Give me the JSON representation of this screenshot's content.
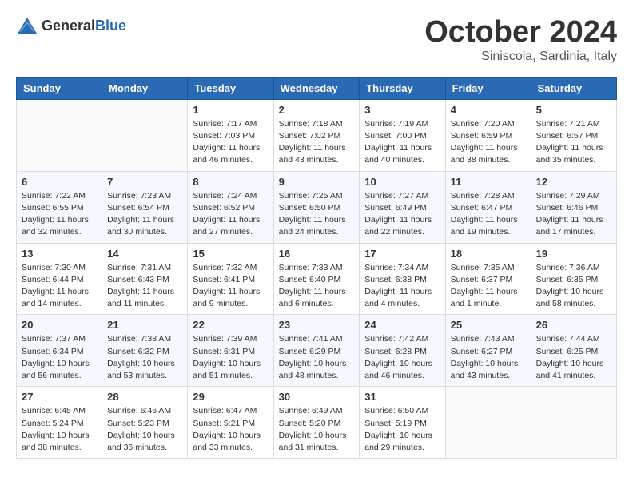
{
  "header": {
    "logo_general": "General",
    "logo_blue": "Blue",
    "month_title": "October 2024",
    "location": "Siniscola, Sardinia, Italy"
  },
  "days_of_week": [
    "Sunday",
    "Monday",
    "Tuesday",
    "Wednesday",
    "Thursday",
    "Friday",
    "Saturday"
  ],
  "weeks": [
    [
      {
        "day": "",
        "info": ""
      },
      {
        "day": "",
        "info": ""
      },
      {
        "day": "1",
        "info": "Sunrise: 7:17 AM\nSunset: 7:03 PM\nDaylight: 11 hours and 46 minutes."
      },
      {
        "day": "2",
        "info": "Sunrise: 7:18 AM\nSunset: 7:02 PM\nDaylight: 11 hours and 43 minutes."
      },
      {
        "day": "3",
        "info": "Sunrise: 7:19 AM\nSunset: 7:00 PM\nDaylight: 11 hours and 40 minutes."
      },
      {
        "day": "4",
        "info": "Sunrise: 7:20 AM\nSunset: 6:59 PM\nDaylight: 11 hours and 38 minutes."
      },
      {
        "day": "5",
        "info": "Sunrise: 7:21 AM\nSunset: 6:57 PM\nDaylight: 11 hours and 35 minutes."
      }
    ],
    [
      {
        "day": "6",
        "info": "Sunrise: 7:22 AM\nSunset: 6:55 PM\nDaylight: 11 hours and 32 minutes."
      },
      {
        "day": "7",
        "info": "Sunrise: 7:23 AM\nSunset: 6:54 PM\nDaylight: 11 hours and 30 minutes."
      },
      {
        "day": "8",
        "info": "Sunrise: 7:24 AM\nSunset: 6:52 PM\nDaylight: 11 hours and 27 minutes."
      },
      {
        "day": "9",
        "info": "Sunrise: 7:25 AM\nSunset: 6:50 PM\nDaylight: 11 hours and 24 minutes."
      },
      {
        "day": "10",
        "info": "Sunrise: 7:27 AM\nSunset: 6:49 PM\nDaylight: 11 hours and 22 minutes."
      },
      {
        "day": "11",
        "info": "Sunrise: 7:28 AM\nSunset: 6:47 PM\nDaylight: 11 hours and 19 minutes."
      },
      {
        "day": "12",
        "info": "Sunrise: 7:29 AM\nSunset: 6:46 PM\nDaylight: 11 hours and 17 minutes."
      }
    ],
    [
      {
        "day": "13",
        "info": "Sunrise: 7:30 AM\nSunset: 6:44 PM\nDaylight: 11 hours and 14 minutes."
      },
      {
        "day": "14",
        "info": "Sunrise: 7:31 AM\nSunset: 6:43 PM\nDaylight: 11 hours and 11 minutes."
      },
      {
        "day": "15",
        "info": "Sunrise: 7:32 AM\nSunset: 6:41 PM\nDaylight: 11 hours and 9 minutes."
      },
      {
        "day": "16",
        "info": "Sunrise: 7:33 AM\nSunset: 6:40 PM\nDaylight: 11 hours and 6 minutes."
      },
      {
        "day": "17",
        "info": "Sunrise: 7:34 AM\nSunset: 6:38 PM\nDaylight: 11 hours and 4 minutes."
      },
      {
        "day": "18",
        "info": "Sunrise: 7:35 AM\nSunset: 6:37 PM\nDaylight: 11 hours and 1 minute."
      },
      {
        "day": "19",
        "info": "Sunrise: 7:36 AM\nSunset: 6:35 PM\nDaylight: 10 hours and 58 minutes."
      }
    ],
    [
      {
        "day": "20",
        "info": "Sunrise: 7:37 AM\nSunset: 6:34 PM\nDaylight: 10 hours and 56 minutes."
      },
      {
        "day": "21",
        "info": "Sunrise: 7:38 AM\nSunset: 6:32 PM\nDaylight: 10 hours and 53 minutes."
      },
      {
        "day": "22",
        "info": "Sunrise: 7:39 AM\nSunset: 6:31 PM\nDaylight: 10 hours and 51 minutes."
      },
      {
        "day": "23",
        "info": "Sunrise: 7:41 AM\nSunset: 6:29 PM\nDaylight: 10 hours and 48 minutes."
      },
      {
        "day": "24",
        "info": "Sunrise: 7:42 AM\nSunset: 6:28 PM\nDaylight: 10 hours and 46 minutes."
      },
      {
        "day": "25",
        "info": "Sunrise: 7:43 AM\nSunset: 6:27 PM\nDaylight: 10 hours and 43 minutes."
      },
      {
        "day": "26",
        "info": "Sunrise: 7:44 AM\nSunset: 6:25 PM\nDaylight: 10 hours and 41 minutes."
      }
    ],
    [
      {
        "day": "27",
        "info": "Sunrise: 6:45 AM\nSunset: 5:24 PM\nDaylight: 10 hours and 38 minutes."
      },
      {
        "day": "28",
        "info": "Sunrise: 6:46 AM\nSunset: 5:23 PM\nDaylight: 10 hours and 36 minutes."
      },
      {
        "day": "29",
        "info": "Sunrise: 6:47 AM\nSunset: 5:21 PM\nDaylight: 10 hours and 33 minutes."
      },
      {
        "day": "30",
        "info": "Sunrise: 6:49 AM\nSunset: 5:20 PM\nDaylight: 10 hours and 31 minutes."
      },
      {
        "day": "31",
        "info": "Sunrise: 6:50 AM\nSunset: 5:19 PM\nDaylight: 10 hours and 29 minutes."
      },
      {
        "day": "",
        "info": ""
      },
      {
        "day": "",
        "info": ""
      }
    ]
  ]
}
